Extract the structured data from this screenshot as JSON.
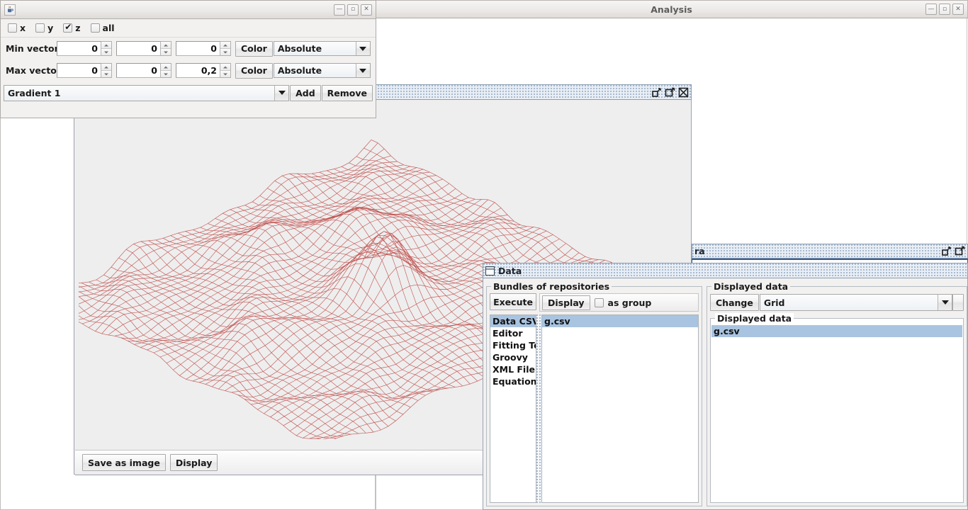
{
  "gradient_window": {
    "title_icon": "java-coffee-cup-icon",
    "window_buttons": [
      "minimize",
      "maximize",
      "close"
    ],
    "axis_checkboxes": [
      {
        "label": "x",
        "checked": false
      },
      {
        "label": "y",
        "checked": false
      },
      {
        "label": "z",
        "checked": true
      },
      {
        "label": "all",
        "checked": false
      }
    ],
    "rows": [
      {
        "label": "Min vector:",
        "values": [
          "0",
          "0",
          "0"
        ],
        "color_button": "Color",
        "mode": "Absolute"
      },
      {
        "label": "Max vector:",
        "values": [
          "0",
          "0",
          "0,2"
        ],
        "color_button": "Color",
        "mode": "Absolute"
      }
    ],
    "gradient_selected": "Gradient 1",
    "add_label": "Add",
    "remove_label": "Remove"
  },
  "analysis_window": {
    "title": "Analysis",
    "window_buttons": [
      "minimize",
      "maximize",
      "close"
    ]
  },
  "plot_frame": {
    "title": "",
    "buttons": [
      "restore",
      "maximize",
      "close"
    ],
    "save_as_image_label": "Save as image",
    "display_label": "Display",
    "mesh_color": "#c0504d",
    "background": "#eeeeee"
  },
  "spectra_frame": {
    "title": "ra",
    "buttons": [
      "restore",
      "maximize"
    ]
  },
  "data_dialog": {
    "title": "Data",
    "title_icon": "window-icon",
    "bundles_group": {
      "title": "Bundles of repositories",
      "execute_label": "Execute",
      "display_label": "Display",
      "as_group_label": "as group",
      "as_group_checked": false,
      "repositories": [
        {
          "label": "Data CSV",
          "selected": true
        },
        {
          "label": "Editor",
          "selected": false
        },
        {
          "label": "Fitting To",
          "selected": false
        },
        {
          "label": "Groovy",
          "selected": false
        },
        {
          "label": "XML File",
          "selected": false
        },
        {
          "label": "Equation",
          "selected": false
        }
      ],
      "files": [
        {
          "label": "g.csv",
          "selected": true
        }
      ]
    },
    "displayed_group": {
      "title": "Displayed data",
      "change_label": "Change",
      "view_mode": "Grid",
      "inner_title": "Displayed data",
      "items": [
        {
          "label": "g.csv",
          "selected": true
        }
      ]
    }
  },
  "colors": {
    "selection_blue": "#a9c4e0",
    "panel_gray": "#f2f1f0",
    "mesh_red": "#c0504d"
  }
}
